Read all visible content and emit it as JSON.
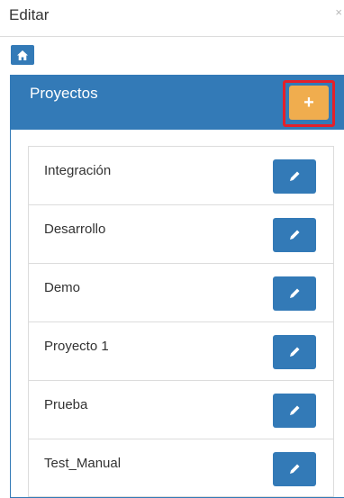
{
  "header": {
    "title": "Editar",
    "close_glyph": "×"
  },
  "nav": {
    "home_icon": "home-icon"
  },
  "panel": {
    "title": "Proyectos",
    "add_label": "+",
    "accent_color": "#337ab7",
    "add_color": "#f0ad4e",
    "highlight_color": "#e4202a"
  },
  "projects": [
    {
      "name": "Integración"
    },
    {
      "name": "Desarrollo"
    },
    {
      "name": "Demo"
    },
    {
      "name": "Proyecto 1"
    },
    {
      "name": "Prueba"
    },
    {
      "name": "Test_Manual"
    }
  ]
}
